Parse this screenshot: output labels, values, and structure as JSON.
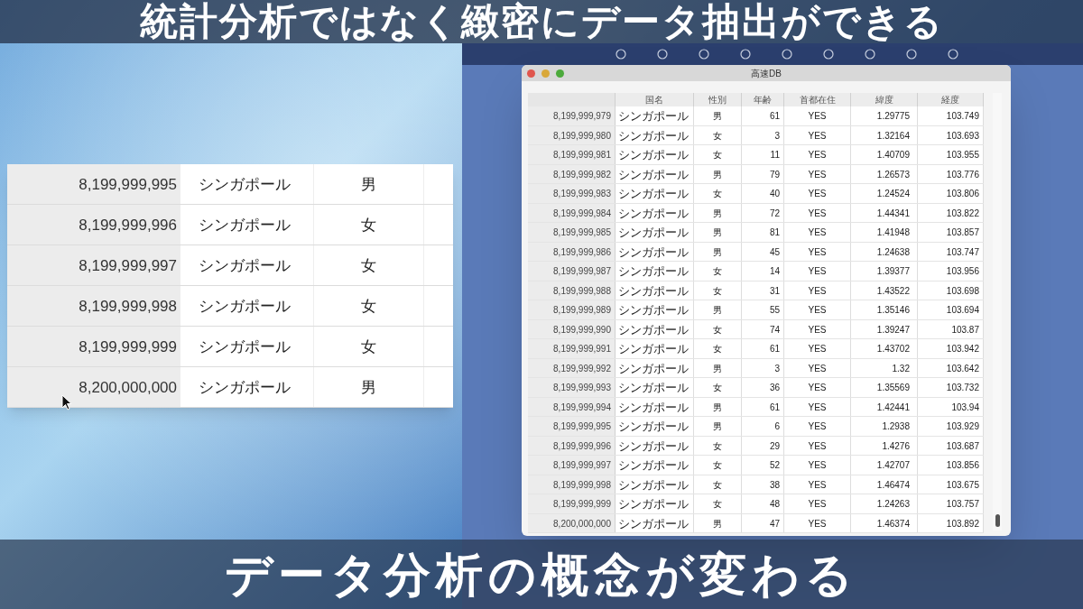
{
  "captions": {
    "top": "統計分析ではなく緻密にデータ抽出ができる",
    "bottom": "データ分析の概念が変わる"
  },
  "zoom_table": {
    "rows": [
      [
        "8,199,999,995",
        "シンガポール",
        "男"
      ],
      [
        "8,199,999,996",
        "シンガポール",
        "女"
      ],
      [
        "8,199,999,997",
        "シンガポール",
        "女"
      ],
      [
        "8,199,999,998",
        "シンガポール",
        "女"
      ],
      [
        "8,199,999,999",
        "シンガポール",
        "女"
      ],
      [
        "8,200,000,000",
        "シンガポール",
        "男"
      ]
    ]
  },
  "window": {
    "title": "高速DB",
    "columns": [
      "",
      "国名",
      "性別",
      "年齢",
      "首都在住",
      "緯度",
      "経度"
    ],
    "rows": [
      [
        "8,199,999,979",
        "シンガポール",
        "男",
        "61",
        "YES",
        "1.29775",
        "103.749"
      ],
      [
        "8,199,999,980",
        "シンガポール",
        "女",
        "3",
        "YES",
        "1.32164",
        "103.693"
      ],
      [
        "8,199,999,981",
        "シンガポール",
        "女",
        "11",
        "YES",
        "1.40709",
        "103.955"
      ],
      [
        "8,199,999,982",
        "シンガポール",
        "男",
        "79",
        "YES",
        "1.26573",
        "103.776"
      ],
      [
        "8,199,999,983",
        "シンガポール",
        "女",
        "40",
        "YES",
        "1.24524",
        "103.806"
      ],
      [
        "8,199,999,984",
        "シンガポール",
        "男",
        "72",
        "YES",
        "1.44341",
        "103.822"
      ],
      [
        "8,199,999,985",
        "シンガポール",
        "男",
        "81",
        "YES",
        "1.41948",
        "103.857"
      ],
      [
        "8,199,999,986",
        "シンガポール",
        "男",
        "45",
        "YES",
        "1.24638",
        "103.747"
      ],
      [
        "8,199,999,987",
        "シンガポール",
        "女",
        "14",
        "YES",
        "1.39377",
        "103.956"
      ],
      [
        "8,199,999,988",
        "シンガポール",
        "女",
        "31",
        "YES",
        "1.43522",
        "103.698"
      ],
      [
        "8,199,999,989",
        "シンガポール",
        "男",
        "55",
        "YES",
        "1.35146",
        "103.694"
      ],
      [
        "8,199,999,990",
        "シンガポール",
        "女",
        "74",
        "YES",
        "1.39247",
        "103.87"
      ],
      [
        "8,199,999,991",
        "シンガポール",
        "女",
        "61",
        "YES",
        "1.43702",
        "103.942"
      ],
      [
        "8,199,999,992",
        "シンガポール",
        "男",
        "3",
        "YES",
        "1.32",
        "103.642"
      ],
      [
        "8,199,999,993",
        "シンガポール",
        "女",
        "36",
        "YES",
        "1.35569",
        "103.732"
      ],
      [
        "8,199,999,994",
        "シンガポール",
        "男",
        "61",
        "YES",
        "1.42441",
        "103.94"
      ],
      [
        "8,199,999,995",
        "シンガポール",
        "男",
        "6",
        "YES",
        "1.2938",
        "103.929"
      ],
      [
        "8,199,999,996",
        "シンガポール",
        "女",
        "29",
        "YES",
        "1.4276",
        "103.687"
      ],
      [
        "8,199,999,997",
        "シンガポール",
        "女",
        "52",
        "YES",
        "1.42707",
        "103.856"
      ],
      [
        "8,199,999,998",
        "シンガポール",
        "女",
        "38",
        "YES",
        "1.46474",
        "103.675"
      ],
      [
        "8,199,999,999",
        "シンガポール",
        "女",
        "48",
        "YES",
        "1.24263",
        "103.757"
      ],
      [
        "8,200,000,000",
        "シンガポール",
        "男",
        "47",
        "YES",
        "1.46374",
        "103.892"
      ]
    ]
  }
}
